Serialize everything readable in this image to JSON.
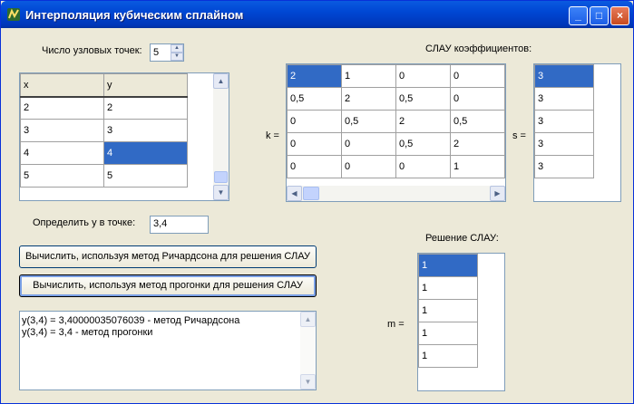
{
  "window": {
    "title": "Интерполяция кубическим сплайном"
  },
  "nodes_label": "Число узловых точек:",
  "nodes_count": "5",
  "xy_table": {
    "headers": [
      "x",
      "y"
    ],
    "rows": [
      [
        "2",
        "2"
      ],
      [
        "3",
        "3"
      ],
      [
        "4",
        "4"
      ],
      [
        "5",
        "5"
      ]
    ]
  },
  "slau_label": "СЛАУ коэффициентов:",
  "k_label": "k =",
  "k_matrix": [
    [
      "2",
      "1",
      "0",
      "0"
    ],
    [
      "0,5",
      "2",
      "0,5",
      "0"
    ],
    [
      "0",
      "0,5",
      "2",
      "0,5"
    ],
    [
      "0",
      "0",
      "0,5",
      "2"
    ],
    [
      "0",
      "0",
      "0",
      "1"
    ]
  ],
  "s_label": "s =",
  "s_vector": [
    "3",
    "3",
    "3",
    "3",
    "3"
  ],
  "point_label": "Определить у в точке:",
  "point_value": "3,4",
  "richardson_button": "Вычислить, используя метод Ричардсона для решения СЛАУ",
  "sweep_button": "Вычислить, используя метод прогонки для решения СЛАУ",
  "output_lines": [
    "y(3,4) = 3,40000035076039 - метод Ричардсона",
    "y(3,4) = 3,4 - метод прогонки"
  ],
  "solution_label": "Решение СЛАУ:",
  "m_label": "m =",
  "m_vector": [
    "1",
    "1",
    "1",
    "1",
    "1"
  ],
  "colors": {
    "selection": "#316ac5",
    "titlebar": "#0047d4",
    "face": "#ece9d8"
  }
}
